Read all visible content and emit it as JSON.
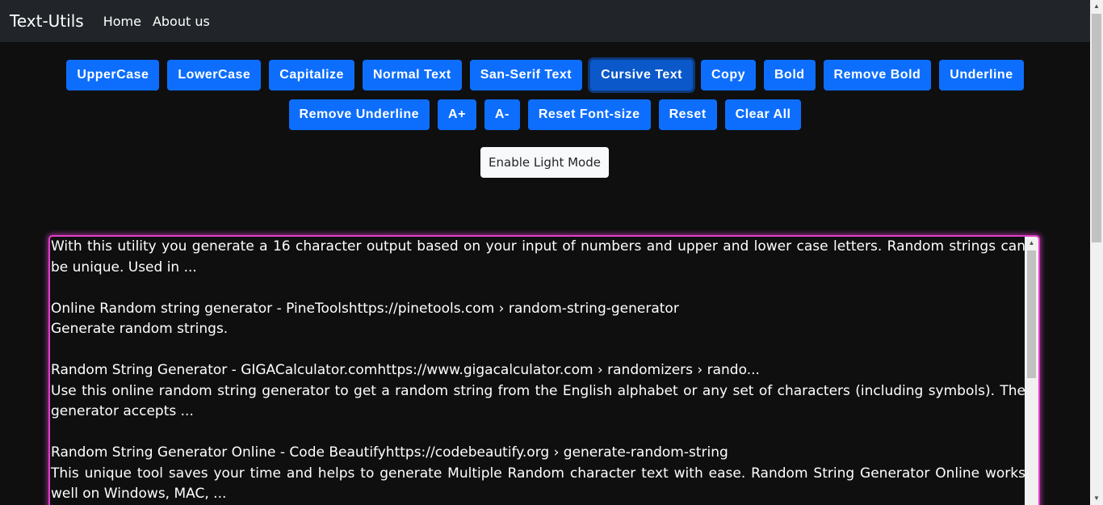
{
  "navbar": {
    "brand": "Text-Utils",
    "links": [
      "Home",
      "About us"
    ]
  },
  "toolbar": {
    "row1": [
      "UpperCase",
      "LowerCase",
      "Capitalize",
      "Normal Text",
      "San-Serif Text",
      "Cursive Text",
      "Copy",
      "Bold",
      "Remove Bold",
      "Underline"
    ],
    "row2": [
      "Remove Underline",
      "A+",
      "A-",
      "Reset Font-size",
      "Reset",
      "Clear All"
    ],
    "active": "Cursive Text"
  },
  "mode_button": "Enable Light Mode",
  "textarea": {
    "content": "With this utility you generate a 16 character output based on your input of numbers and upper and lower case letters. Random strings can be unique. Used in ...\n\nOnline Random string generator - PineToolshttps://pinetools.com › random-string-generator\nGenerate random strings.\n\nRandom String Generator - GIGACalculator.comhttps://www.gigacalculator.com › randomizers › rando...\nUse this online random string generator to get a random string from the English alphabet or any set of characters (including symbols). The generator accepts ...\n\nRandom String Generator Online - Code Beautifyhttps://codebeautify.org › generate-random-string\nThis unique tool saves your time and helps to generate Multiple Random character text with ease. Random String Generator Online works well on Windows, MAC, ..."
  },
  "colors": {
    "primary": "#0d6efd",
    "navbar_bg": "#212529",
    "page_bg": "#0f0f10",
    "textarea_border": "#e040c8"
  },
  "icons": {
    "scroll_up": "▲",
    "scroll_down": "▼"
  }
}
